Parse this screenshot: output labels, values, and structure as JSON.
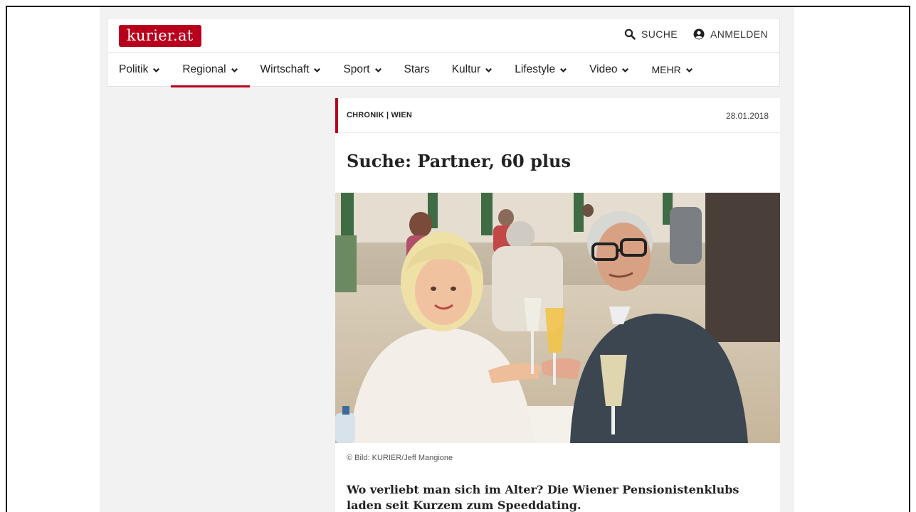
{
  "brand": {
    "logo": "kurier.at",
    "accent": "#b8001c"
  },
  "top_actions": {
    "search_label": "SUCHE",
    "login_label": "ANMELDEN"
  },
  "nav": {
    "items": [
      {
        "label": "Politik",
        "dropdown": true
      },
      {
        "label": "Regional",
        "dropdown": true,
        "active": true
      },
      {
        "label": "Wirtschaft",
        "dropdown": true
      },
      {
        "label": "Sport",
        "dropdown": true
      },
      {
        "label": "Stars",
        "dropdown": false
      },
      {
        "label": "Kultur",
        "dropdown": true
      },
      {
        "label": "Lifestyle",
        "dropdown": true
      },
      {
        "label": "Video",
        "dropdown": true
      },
      {
        "label": "MEHR",
        "dropdown": true
      }
    ]
  },
  "article": {
    "category": "CHRONIK | WIEN",
    "date": "28.01.2018",
    "title": "Suche: Partner, 60 plus",
    "image_credit": "© Bild: KURIER/Jeff Mangione",
    "lead": "Wo verliebt man sich im Alter? Die Wiener Pensionistenklubs laden seit Kurzem zum Speeddating."
  }
}
